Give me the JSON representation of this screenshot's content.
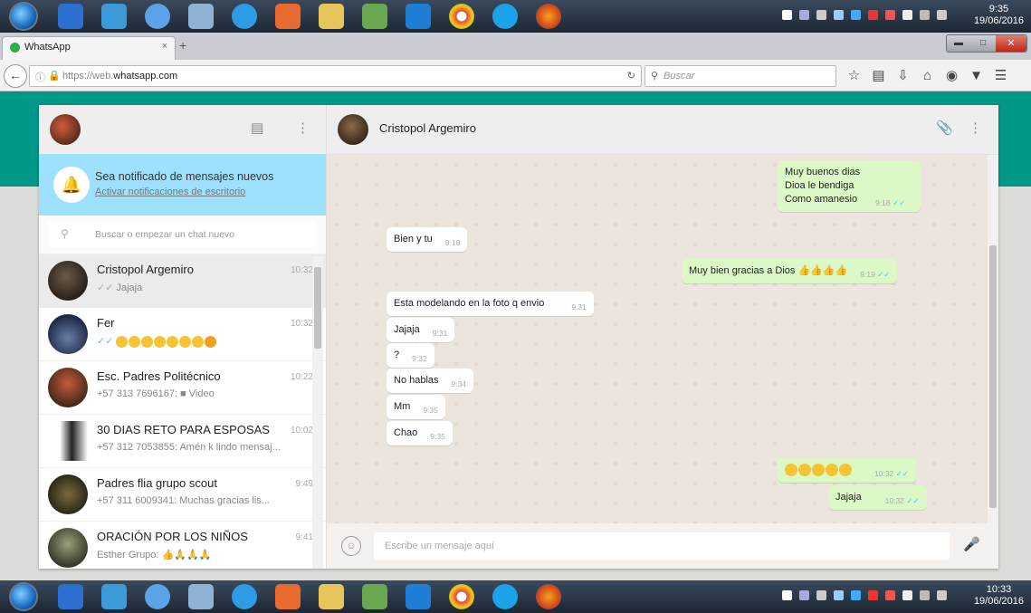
{
  "os": {
    "taskbar_top_clock": {
      "time": "9:35",
      "date": "19/06/2016"
    },
    "taskbar_bottom_clock": {
      "time": "10:33",
      "date": "19/06/2016"
    }
  },
  "browser": {
    "tab_title": "WhatsApp",
    "tab_close": "×",
    "new_tab": "+",
    "url_prefix": "https://web.",
    "url_domain": "whatsapp.com",
    "search_placeholder": "Buscar"
  },
  "sidebar": {
    "notification_title": "Sea notificado de mensajes nuevos",
    "notification_link": "Activar notificaciones de escritorio",
    "search_placeholder": "Buscar o empezar un chat nuevo",
    "chats": [
      {
        "name": "Cristopol Argemiro",
        "time": "10:32",
        "last": "Jajaja",
        "ticks": "✓✓"
      },
      {
        "name": "Fer",
        "time": "10:32",
        "last": "",
        "ticks": "✓✓"
      },
      {
        "name": "Esc. Padres Politécnico",
        "time": "10:22",
        "last": "+57 313 7696167: ■ Video"
      },
      {
        "name": "30 DIAS RETO PARA ESPOSAS",
        "time": "10:02",
        "last": "+57 312 7053855: Amén k lindo mensaj..."
      },
      {
        "name": "Padres flia grupo scout",
        "time": "9:49",
        "last": "+57 311 6009341: Muchas gracias lis..."
      },
      {
        "name": "ORACIÓN POR LOS NIÑOS",
        "time": "9:41",
        "last": "Esther Grupo:"
      }
    ]
  },
  "conversation": {
    "contact_name": "Cristopol Argemiro",
    "compose_placeholder": "Escribe un mensaje aquí",
    "messages": [
      {
        "dir": "out",
        "lines": [
          "Muy buenos dias",
          "Dioa le bendiga",
          "Como amanesio"
        ],
        "time": "9:18"
      },
      {
        "dir": "in",
        "text": "Bien y tu",
        "time": "9:18"
      },
      {
        "dir": "out",
        "text": "Muy bien gracias a Dios",
        "time": "9:19"
      },
      {
        "dir": "in",
        "text": "Esta modelando en la foto q envio",
        "time": "9:31"
      },
      {
        "dir": "in",
        "text": "Jajaja",
        "time": "9:31"
      },
      {
        "dir": "in",
        "text": "?",
        "time": "9:32"
      },
      {
        "dir": "in",
        "text": "No hablas",
        "time": "9:34"
      },
      {
        "dir": "in",
        "text": "Mm",
        "time": "9:35"
      },
      {
        "dir": "in",
        "text": "Chao",
        "time": "9:35"
      },
      {
        "dir": "out",
        "text": "",
        "time": "10:32"
      },
      {
        "dir": "out",
        "text": "Jajaja",
        "time": "10:32"
      }
    ]
  },
  "colors": {
    "teal_band": "#009688",
    "notification_bg": "#9de1fe",
    "outgoing_bubble": "#dcf8c6"
  }
}
